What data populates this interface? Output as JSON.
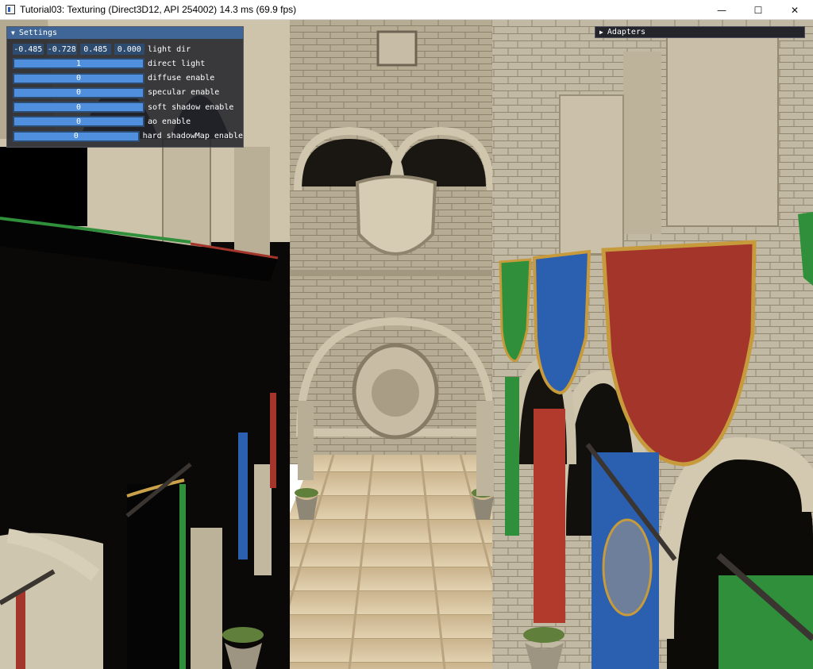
{
  "window": {
    "title": "Tutorial03: Texturing (Direct3D12, API 254002)   14.3 ms (69.9 fps)",
    "minimize_glyph": "—",
    "maximize_glyph": "☐",
    "close_glyph": "✕",
    "icon": "app-window-icon"
  },
  "settings": {
    "title": "Settings",
    "collapse_glyph": "▼",
    "light_dir": {
      "label": "light dir",
      "x": "-0.485",
      "y": "-0.728",
      "z": "0.485",
      "w": "0.000"
    },
    "sliders": [
      {
        "label": "direct light",
        "value": "1",
        "fill": 1.0
      },
      {
        "label": "diffuse enable",
        "value": "0",
        "fill": 1.0
      },
      {
        "label": "specular enable",
        "value": "0",
        "fill": 1.0
      },
      {
        "label": "soft shadow enable",
        "value": "0",
        "fill": 1.0
      },
      {
        "label": "ao enable",
        "value": "0",
        "fill": 1.0
      },
      {
        "label": "hard shadowMap enable",
        "value": "0",
        "fill": 1.0
      }
    ]
  },
  "adapters": {
    "title": "Adapters",
    "expand_glyph": "▶"
  },
  "colors": {
    "panel_title": "#3f6696",
    "slider_bg": "#2d4a6f",
    "slider_grab": "#4f8fde",
    "stone": "#b9ad94",
    "banner_red": "#a3352b",
    "banner_blue": "#2b5fb0",
    "banner_green": "#2f8f3a"
  }
}
